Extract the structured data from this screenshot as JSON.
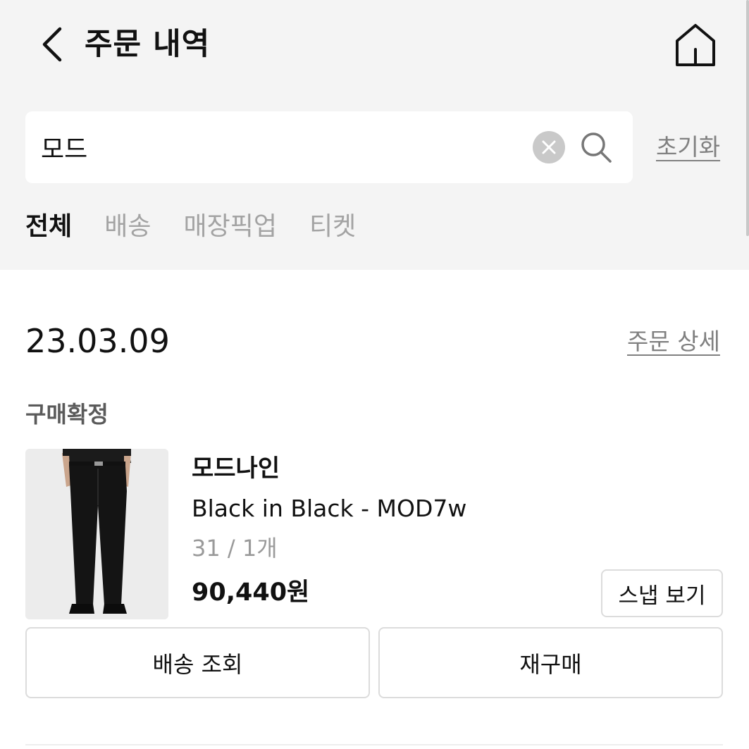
{
  "header": {
    "title": "주문 내역",
    "back_icon": "chevron-left-icon",
    "home_icon": "home-icon"
  },
  "search": {
    "value": "모드",
    "clear_icon": "close-icon",
    "search_icon": "search-icon",
    "reset_label": "초기화"
  },
  "tabs": [
    {
      "label": "전체",
      "active": true
    },
    {
      "label": "배송",
      "active": false
    },
    {
      "label": "매장픽업",
      "active": false
    },
    {
      "label": "티켓",
      "active": false
    }
  ],
  "order": {
    "date": "23.03.09",
    "detail_label": "주문 상세",
    "status": "구매확정",
    "item": {
      "brand": "모드나인",
      "name": "Black in Black - MOD7w",
      "option": "31 / 1개",
      "price": "90,440원",
      "snap_label": "스냅 보기"
    },
    "actions": {
      "track_label": "배송 조회",
      "reorder_label": "재구매"
    }
  },
  "colors": {
    "header_bg": "#f4f4f4",
    "muted_text": "#808080",
    "border": "#dcdcdc"
  }
}
